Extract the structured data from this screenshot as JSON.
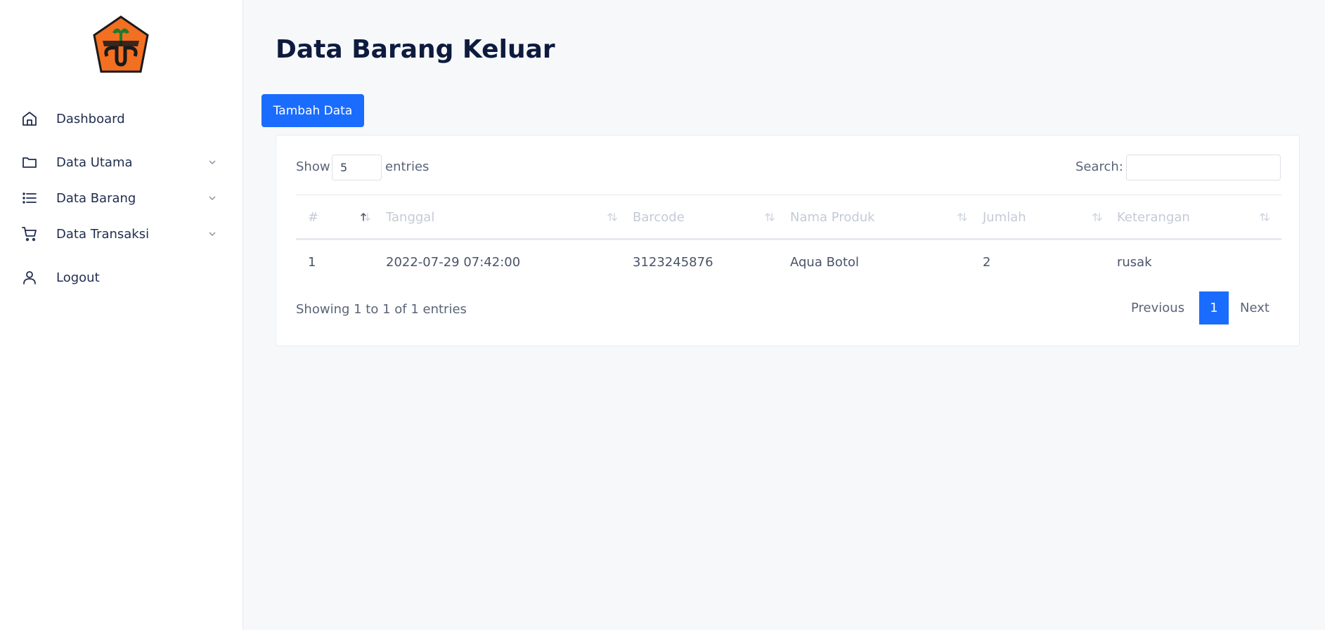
{
  "colors": {
    "accent": "#1a6cff",
    "title": "#0d1b3e",
    "logo_orange": "#f36f21"
  },
  "sidebar": {
    "logo_icon": "polije-logo",
    "items": [
      {
        "label": "Dashboard",
        "icon": "home-icon",
        "has_submenu": false
      },
      {
        "label": "Data Utama",
        "icon": "folder-icon",
        "has_submenu": true
      },
      {
        "label": "Data Barang",
        "icon": "list-icon",
        "has_submenu": true
      },
      {
        "label": "Data Transaksi",
        "icon": "cart-icon",
        "has_submenu": true
      },
      {
        "label": "Logout",
        "icon": "user-icon",
        "has_submenu": false
      }
    ]
  },
  "main": {
    "title": "Data Barang Keluar",
    "add_button_label": "Tambah Data"
  },
  "table": {
    "show_label": "Show",
    "entries_value": "5",
    "entries_label": "entries",
    "search_label": "Search:",
    "search_value": "",
    "columns": [
      "#",
      "Tanggal",
      "Barcode",
      "Nama Produk",
      "Jumlah",
      "Keterangan"
    ],
    "sorted_column": "#",
    "rows": [
      [
        "1",
        "2022-07-29 07:42:00",
        "3123245876",
        "Aqua Botol",
        "2",
        "rusak"
      ]
    ],
    "info": "Showing 1 to 1 of 1 entries",
    "pagination": {
      "previous": "Previous",
      "current": "1",
      "next": "Next"
    }
  }
}
